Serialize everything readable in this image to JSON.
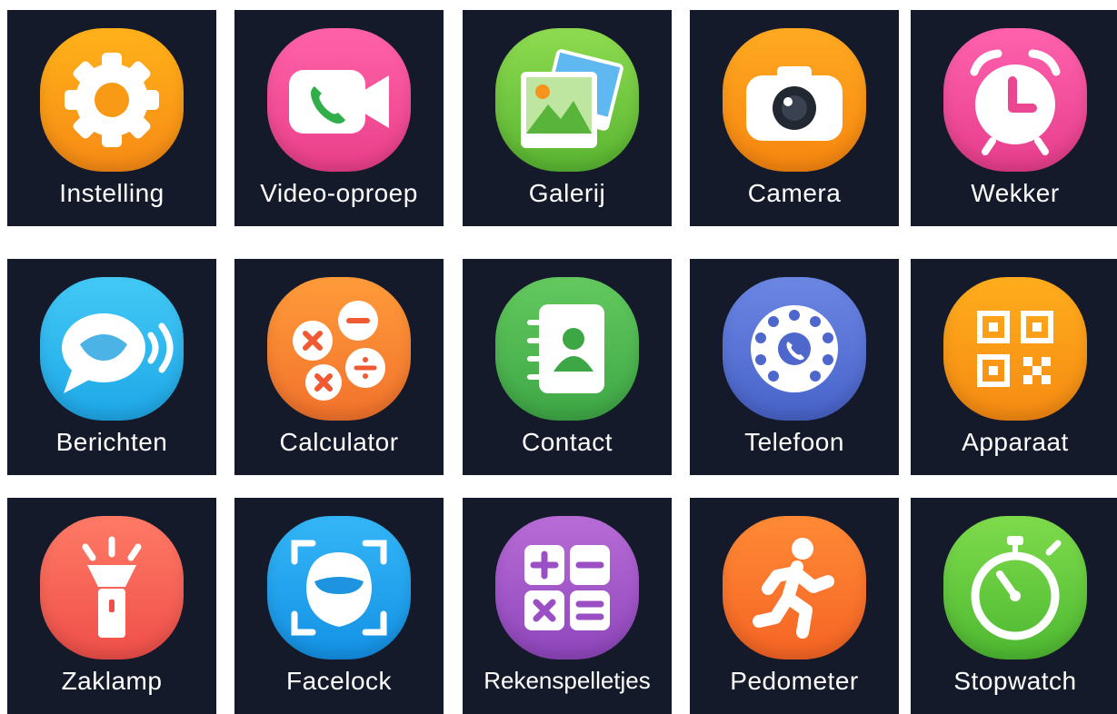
{
  "apps": [
    {
      "label": "Instelling",
      "icon": "gear-icon",
      "color_top": "#ffb21a",
      "color_bottom": "#f78a15"
    },
    {
      "label": "Video-oproep",
      "icon": "video-call-icon",
      "color_top": "#ff62a8",
      "color_bottom": "#ea3f8a"
    },
    {
      "label": "Galerij",
      "icon": "gallery-icon",
      "color_top": "#8edb50",
      "color_bottom": "#59b531"
    },
    {
      "label": "Camera",
      "icon": "camera-icon",
      "color_top": "#ffaa22",
      "color_bottom": "#f7860f"
    },
    {
      "label": "Wekker",
      "icon": "alarm-clock-icon",
      "color_top": "#ff62ae",
      "color_bottom": "#e63d8b"
    },
    {
      "label": "Berichten",
      "icon": "message-icon",
      "color_top": "#43c9f5",
      "color_bottom": "#1ea7e8"
    },
    {
      "label": "Calculator",
      "icon": "calculator-bubbles-icon",
      "color_top": "#ff9b3a",
      "color_bottom": "#f2722c"
    },
    {
      "label": "Contact",
      "icon": "contact-book-icon",
      "color_top": "#63c95f",
      "color_bottom": "#3ea745"
    },
    {
      "label": "Telefoon",
      "icon": "rotary-phone-icon",
      "color_top": "#6c86e4",
      "color_bottom": "#4863c9"
    },
    {
      "label": "Apparaat",
      "icon": "qr-code-icon",
      "color_top": "#ffad1d",
      "color_bottom": "#f58a12"
    },
    {
      "label": "Zaklamp",
      "icon": "flashlight-icon",
      "color_top": "#ff7a66",
      "color_bottom": "#ef4f49"
    },
    {
      "label": "Facelock",
      "icon": "face-scan-icon",
      "color_top": "#34b6f7",
      "color_bottom": "#1491e5"
    },
    {
      "label": "Rekenspelletjes",
      "icon": "math-games-icon",
      "color_top": "#b86cd6",
      "color_bottom": "#8f46bc"
    },
    {
      "label": "Pedometer",
      "icon": "running-person-icon",
      "color_top": "#ff8a36",
      "color_bottom": "#f56424"
    },
    {
      "label": "Stopwatch",
      "icon": "stopwatch-icon",
      "color_top": "#7edb4b",
      "color_bottom": "#4eb932"
    }
  ]
}
